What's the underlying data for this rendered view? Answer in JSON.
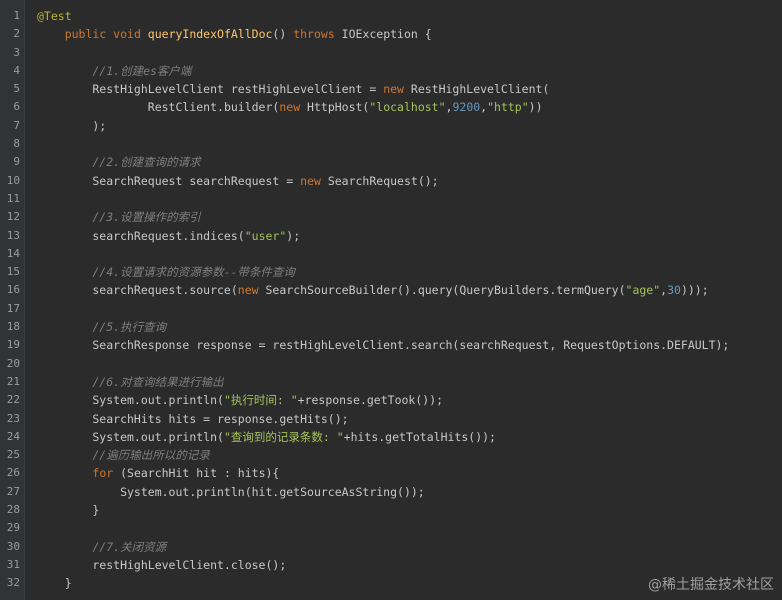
{
  "code_lines": [
    [
      {
        "t": "@Test",
        "c": "ann"
      }
    ],
    [
      {
        "t": "    ",
        "c": "plain"
      },
      {
        "t": "public void ",
        "c": "kw"
      },
      {
        "t": "queryIndexOfAllDoc",
        "c": "fn"
      },
      {
        "t": "() ",
        "c": "plain"
      },
      {
        "t": "throws ",
        "c": "kw"
      },
      {
        "t": "IOException {",
        "c": "plain"
      }
    ],
    [],
    [
      {
        "t": "        //1.创建es客户端",
        "c": "cmt"
      }
    ],
    [
      {
        "t": "        RestHighLevelClient restHighLevelClient = ",
        "c": "plain"
      },
      {
        "t": "new ",
        "c": "kw"
      },
      {
        "t": "RestHighLevelClient(",
        "c": "plain"
      }
    ],
    [
      {
        "t": "                RestClient.",
        "c": "plain"
      },
      {
        "t": "builder",
        "c": "plain"
      },
      {
        "t": "(",
        "c": "plain"
      },
      {
        "t": "new ",
        "c": "kw"
      },
      {
        "t": "HttpHost(",
        "c": "plain"
      },
      {
        "t": "\"localhost\"",
        "c": "str"
      },
      {
        "t": ",",
        "c": "plain"
      },
      {
        "t": "9200",
        "c": "num"
      },
      {
        "t": ",",
        "c": "plain"
      },
      {
        "t": "\"http\"",
        "c": "str"
      },
      {
        "t": "))",
        "c": "plain"
      }
    ],
    [
      {
        "t": "        );",
        "c": "plain"
      }
    ],
    [],
    [
      {
        "t": "        //2.创建查询的请求",
        "c": "cmt"
      }
    ],
    [
      {
        "t": "        SearchRequest searchRequest = ",
        "c": "plain"
      },
      {
        "t": "new ",
        "c": "kw"
      },
      {
        "t": "SearchRequest();",
        "c": "plain"
      }
    ],
    [],
    [
      {
        "t": "        //3.设置操作的索引",
        "c": "cmt"
      }
    ],
    [
      {
        "t": "        searchRequest.indices(",
        "c": "plain"
      },
      {
        "t": "\"user\"",
        "c": "str"
      },
      {
        "t": ");",
        "c": "plain"
      }
    ],
    [],
    [
      {
        "t": "        //4.设置请求的资源参数--带条件查询",
        "c": "cmt"
      }
    ],
    [
      {
        "t": "        searchRequest.source(",
        "c": "plain"
      },
      {
        "t": "new ",
        "c": "kw"
      },
      {
        "t": "SearchSourceBuilder().query(QueryBuilders.termQuery(",
        "c": "plain"
      },
      {
        "t": "\"age\"",
        "c": "str"
      },
      {
        "t": ",",
        "c": "plain"
      },
      {
        "t": "30",
        "c": "num"
      },
      {
        "t": ")));",
        "c": "plain"
      }
    ],
    [],
    [
      {
        "t": "        //5.执行查询",
        "c": "cmt"
      }
    ],
    [
      {
        "t": "        SearchResponse response = restHighLevelClient.search(searchRequest, RequestOptions.DEFAULT);",
        "c": "plain"
      }
    ],
    [],
    [
      {
        "t": "        //6.对查询结果进行输出",
        "c": "cmt"
      }
    ],
    [
      {
        "t": "        System.out.println(",
        "c": "plain"
      },
      {
        "t": "\"执行时间: \"",
        "c": "str"
      },
      {
        "t": "+response.getTook());",
        "c": "plain"
      }
    ],
    [
      {
        "t": "        SearchHits hits = response.getHits();",
        "c": "plain"
      }
    ],
    [
      {
        "t": "        System.out.println(",
        "c": "plain"
      },
      {
        "t": "\"查询到的记录条数: \"",
        "c": "str"
      },
      {
        "t": "+hits.getTotalHits());",
        "c": "plain"
      }
    ],
    [
      {
        "t": "        //遍历输出所以的记录",
        "c": "cmt"
      }
    ],
    [
      {
        "t": "        ",
        "c": "plain"
      },
      {
        "t": "for ",
        "c": "kw"
      },
      {
        "t": "(SearchHit hit : hits){",
        "c": "plain"
      }
    ],
    [
      {
        "t": "            System.out.println(hit.getSourceAsString());",
        "c": "plain"
      }
    ],
    [
      {
        "t": "        }",
        "c": "plain"
      }
    ],
    [],
    [
      {
        "t": "        //7.关闭资源",
        "c": "cmt"
      }
    ],
    [
      {
        "t": "        restHighLevelClient.close();",
        "c": "plain"
      }
    ],
    [
      {
        "t": "    }",
        "c": "plain"
      }
    ]
  ],
  "watermark": "@稀土掘金技术社区"
}
